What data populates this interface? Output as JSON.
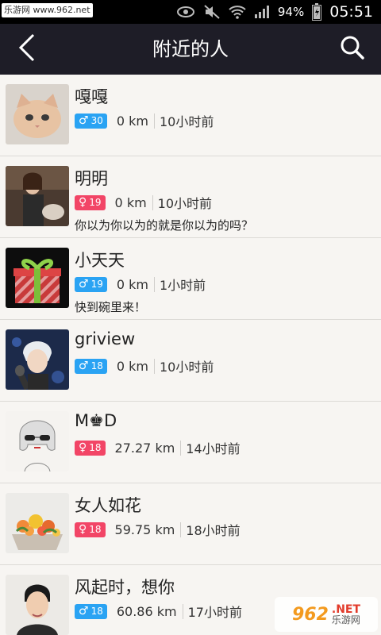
{
  "status_bar": {
    "watermark": "乐游网 www.962.net",
    "battery": "94%",
    "time": "05:51",
    "icons": [
      "eye-icon",
      "mute-icon",
      "wifi-icon",
      "signal-icon",
      "battery-icon"
    ]
  },
  "header": {
    "title": "附近的人",
    "back_icon": "chevron-left-icon",
    "search_icon": "search-icon",
    "bar_color": "#1e1d27"
  },
  "colors": {
    "male": "#2aa3f3",
    "female": "#f24566"
  },
  "people": [
    {
      "name": "嘎嘎",
      "gender": "male",
      "gender_symbol": "♂",
      "age": "30",
      "distance": "0 km",
      "ago": "10小时前",
      "signature": "",
      "avatar": "kitten-avatar"
    },
    {
      "name": "明明",
      "gender": "female",
      "gender_symbol": "♀",
      "age": "19",
      "distance": "0 km",
      "ago": "10小时前",
      "signature": "你以为你以为的就是你以为的吗？",
      "avatar": "woman-with-dog-avatar"
    },
    {
      "name": "小天天",
      "gender": "male",
      "gender_symbol": "♂",
      "age": "19",
      "distance": "0 km",
      "ago": "1小时前",
      "signature": "快到碗里来！",
      "avatar": "gift-box-avatar"
    },
    {
      "name": "griview",
      "gender": "male",
      "gender_symbol": "♂",
      "age": "18",
      "distance": "0 km",
      "ago": "10小时前",
      "signature": "",
      "avatar": "anime-singer-avatar"
    },
    {
      "name": "M♚D",
      "gender": "female",
      "gender_symbol": "♀",
      "age": "18",
      "distance": "27.27 km",
      "ago": "14小时前",
      "signature": "",
      "avatar": "sketch-girl-avatar"
    },
    {
      "name": "女人如花",
      "gender": "female",
      "gender_symbol": "♀",
      "age": "18",
      "distance": "59.75 km",
      "ago": "18小时前",
      "signature": "",
      "avatar": "flower-basket-avatar"
    },
    {
      "name": "风起时，想你",
      "gender": "male",
      "gender_symbol": "♂",
      "age": "18",
      "distance": "60.86 km",
      "ago": "17小时前",
      "signature": "",
      "avatar": "man-portrait-avatar"
    }
  ],
  "watermark_bottom": {
    "number": "962",
    "net": ".NET",
    "cn": "乐游网"
  }
}
